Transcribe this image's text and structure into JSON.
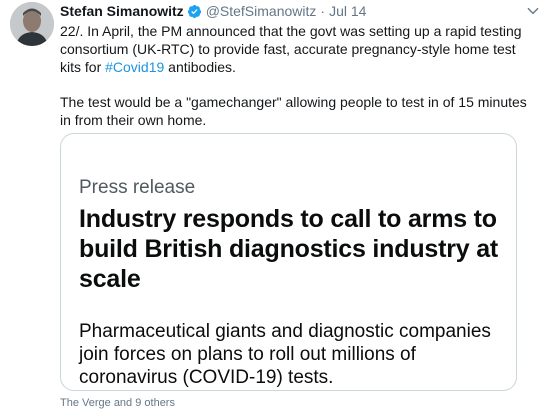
{
  "header": {
    "name": "Stefan Simanowitz",
    "handle": "@StefSimanowitz",
    "separator": "·",
    "date": "Jul 14"
  },
  "body": {
    "line1_before": "22/. In April, the PM announced that the govt was setting up a rapid testing consortium (UK-RTC) to provide fast, accurate pregnancy-style home test kits for ",
    "hashtag": "#Covid19",
    "line1_after": " antibodies.",
    "paragraph2": "The test would be a \"gamechanger\" allowing people to test in of 15 minutes in from their own home."
  },
  "card": {
    "label": "Press release",
    "title": "Industry responds to call to arms to build British diagnostics industry at scale",
    "description": "Pharmaceutical giants and diagnostic companies join forces on plans to roll out millions of coronavirus (COVID-19) tests."
  },
  "footer": {
    "mentions": "The Verge and 9 others"
  },
  "icons": {
    "verified": "verified-badge-icon",
    "more": "chevron-down-icon"
  },
  "colors": {
    "accent": "#1da1f2",
    "link": "#1b95e0",
    "secondary_text": "#657786",
    "card_border": "#ccd6dd"
  }
}
